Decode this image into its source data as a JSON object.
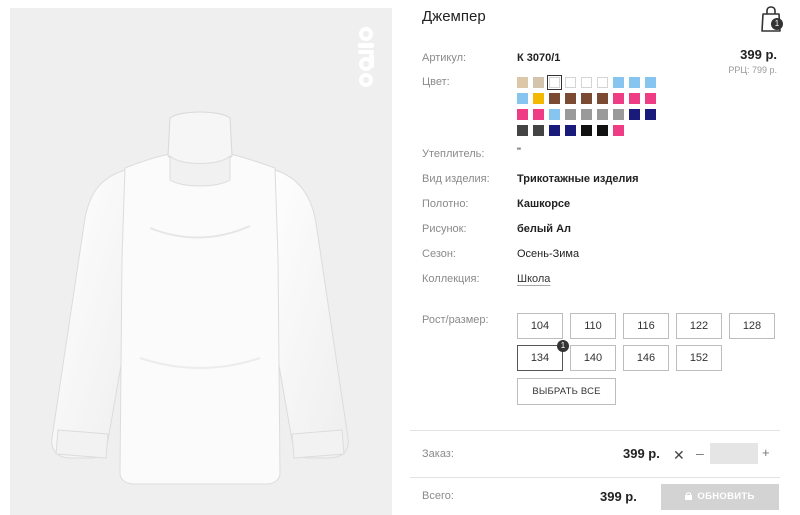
{
  "product": {
    "title": "Джемпер",
    "price": "399 р.",
    "rrc": "РРЦ: 799 р.",
    "brand_logo_text": "orby"
  },
  "cart": {
    "count": "1"
  },
  "attributes": [
    {
      "label": "Артикул:",
      "value": "К 3070/1",
      "style": "bold"
    },
    {
      "label": "Цвет:",
      "value": "",
      "style": "none"
    },
    {
      "label": "Утеплитель:",
      "value": "\"",
      "style": "plain"
    },
    {
      "label": "Вид изделия:",
      "value": "Трикотажные изделия",
      "style": "bold"
    },
    {
      "label": "Полотно:",
      "value": "Кашкорсе",
      "style": "bold"
    },
    {
      "label": "Рисунок:",
      "value": "белый Ал",
      "style": "bold"
    },
    {
      "label": "Сезон:",
      "value": "Осень-Зима",
      "style": "plain"
    },
    {
      "label": "Коллекция:",
      "value": "Школа",
      "style": "link"
    }
  ],
  "colors": [
    "#dcc7a8",
    "#d4c4ad",
    "#ffffff",
    "#ffffff",
    "#ffffff",
    "#ffffff",
    "#86c5f0",
    "#86c5f0",
    "#86c5f0",
    "#86c5f0",
    "#f5b800",
    "#7a4a33",
    "#7a4a33",
    "#7a4a33",
    "#7a4a33",
    "#ee3d84",
    "#ee3d84",
    "#ee3d84",
    "#ee3d84",
    "#ee3d84",
    "#86c5f0",
    "#9a9a9a",
    "#9a9a9a",
    "#9a9a9a",
    "#9a9a9a",
    "#1a1a7a",
    "#1a1a7a",
    "#444444",
    "#444444",
    "#1a1a7a",
    "#1a1a7a",
    "#111111",
    "#111111",
    "#ee3d84"
  ],
  "selected_color_index": 2,
  "size_label": "Рост/размер:",
  "sizes": [
    "104",
    "110",
    "116",
    "122",
    "128",
    "134",
    "140",
    "146",
    "152"
  ],
  "selected_size": "134",
  "selected_size_count": "1",
  "select_all_label": "ВЫБРАТЬ ВСЕ",
  "order": {
    "label": "Заказ:",
    "total": "399 р.",
    "remove_symbol": "✕",
    "minus": "–",
    "plus": "+",
    "quantity": ""
  },
  "summary": {
    "label": "Всего:",
    "total": "399 р.",
    "update_label": "ОБНОВИТЬ"
  }
}
